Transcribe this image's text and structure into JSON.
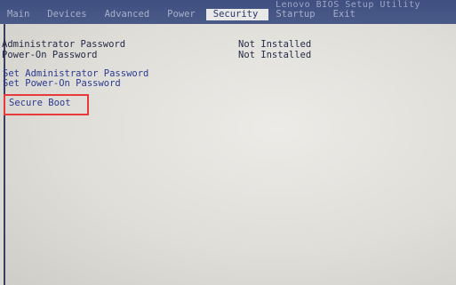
{
  "header": {
    "utility_title": "Lenovo BIOS Setup Utility",
    "tabs": [
      "Main",
      "Devices",
      "Advanced",
      "Power",
      "Security",
      "Startup",
      "Exit"
    ],
    "active_tab": "Security"
  },
  "security": {
    "status_items": [
      {
        "label": "Administrator Password",
        "value": "Not Installed"
      },
      {
        "label": "Power-On Password",
        "value": "Not Installed"
      }
    ],
    "actions": [
      {
        "label": "Set Administrator Password"
      },
      {
        "label": "Set Power-On Password"
      }
    ],
    "secure_boot": {
      "label": "Secure Boot"
    }
  },
  "colors": {
    "header_bg": "#3f4f80",
    "highlight_box": "#e83a3a"
  }
}
